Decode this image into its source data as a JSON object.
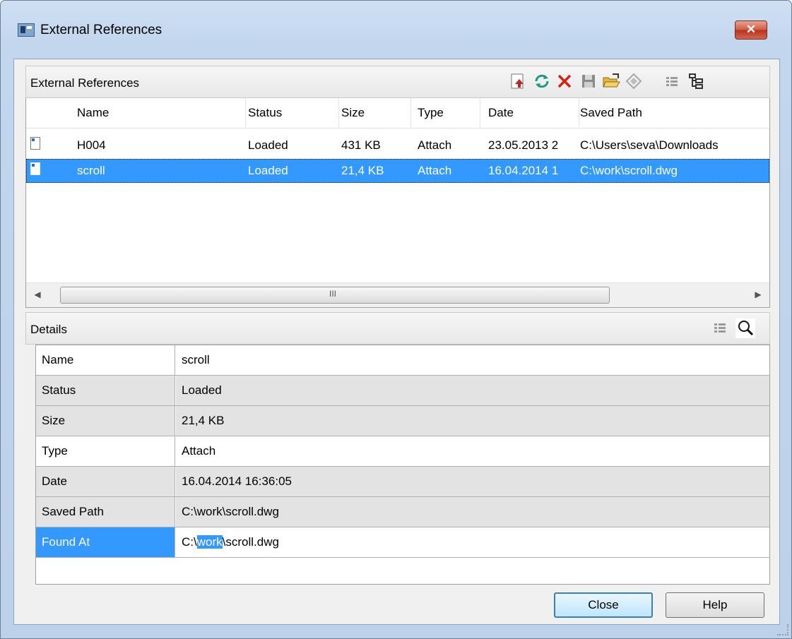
{
  "window": {
    "title": "External References",
    "close_glyph": "✕"
  },
  "refs_panel": {
    "title": "External References",
    "toolbar": {
      "attach_icon": "attach-icon",
      "refresh_icon": "refresh-icon",
      "detach_icon": "detach-icon",
      "save_icon": "save-icon",
      "open_icon": "open-folder-icon",
      "bind_icon": "bind-icon",
      "list_view_icon": "list-view-icon",
      "tree_view_icon": "tree-view-icon"
    },
    "columns": [
      "Name",
      "Status",
      "Size",
      "Type",
      "Date",
      "Saved Path"
    ],
    "rows": [
      {
        "name": "H004",
        "status": "Loaded",
        "size": "431 KB",
        "type": "Attach",
        "date": "23.05.2013 2",
        "path": "C:\\Users\\seva\\Downloads"
      },
      {
        "name": "scroll",
        "status": "Loaded",
        "size": "21,4 KB",
        "type": "Attach",
        "date": "16.04.2014 1",
        "path": "C:\\work\\scroll.dwg"
      }
    ],
    "scroll_grip": "III"
  },
  "details_panel": {
    "title": "Details",
    "rows": [
      {
        "label": "Name",
        "value": "scroll"
      },
      {
        "label": "Status",
        "value": "Loaded"
      },
      {
        "label": "Size",
        "value": "21,4 KB"
      },
      {
        "label": "Type",
        "value": "Attach"
      },
      {
        "label": "Date",
        "value": "16.04.2014 16:36:05"
      },
      {
        "label": "Saved Path",
        "value": "C:\\work\\scroll.dwg"
      }
    ],
    "found_at": {
      "label": "Found At",
      "prefix": "C:\\",
      "selected": "work",
      "suffix": "\\scroll.dwg"
    }
  },
  "buttons": {
    "close": "Close",
    "help": "Help"
  },
  "colors": {
    "selection": "#3399ff",
    "frame": "#c2d6ee"
  }
}
